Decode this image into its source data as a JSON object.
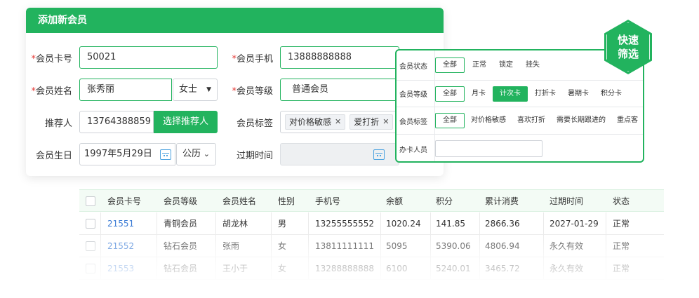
{
  "form": {
    "title": "添加新会员",
    "card_no": {
      "label_star": "*",
      "label": "会员卡号",
      "value": "50021"
    },
    "phone": {
      "label_star": "*",
      "label": "会员手机",
      "value": "13888888888"
    },
    "name": {
      "label_star": "*",
      "label": "会员姓名",
      "value": "张秀丽",
      "gender": "女士"
    },
    "level": {
      "label_star": "*",
      "label": "会员等级",
      "value": "普通会员"
    },
    "referrer": {
      "label": "推荐人",
      "value": "13764388859",
      "button": "选择推荐人"
    },
    "tags": {
      "label": "会员标签",
      "items": [
        "对价格敏感",
        "爱打折"
      ]
    },
    "birthday": {
      "label": "会员生日",
      "value": "1997年5月29日",
      "calendar_type": "公历"
    },
    "expire": {
      "label": "过期时间",
      "value": ""
    }
  },
  "quick_filter": {
    "badge_line1": "快速",
    "badge_line2": "筛选",
    "status": {
      "label": "会员状态",
      "options": [
        "全部",
        "正常",
        "锁定",
        "挂失"
      ],
      "selected": "全部"
    },
    "level": {
      "label": "会员等级",
      "options": [
        "全部",
        "月卡",
        "计次卡",
        "打折卡",
        "暑期卡",
        "积分卡"
      ],
      "selected": "计次卡"
    },
    "tags": {
      "label": "会员标签",
      "options": [
        "全部",
        "对价格敏感",
        "喜欢打折",
        "需要长期跟进的",
        "重点客"
      ],
      "selected": "全部"
    },
    "staff": {
      "label": "办卡人员",
      "value": ""
    }
  },
  "table": {
    "headers": [
      "会员卡号",
      "会员等级",
      "会员姓名",
      "性别",
      "手机号",
      "余额",
      "积分",
      "累计消费",
      "过期时间",
      "状态"
    ],
    "rows": [
      [
        "21551",
        "青铜会员",
        "胡龙林",
        "男",
        "13255555552",
        "1020.24",
        "141.85",
        "2866.36",
        "2027-01-29",
        "正常"
      ],
      [
        "21552",
        "钻石会员",
        "张雨",
        "女",
        "13811111111",
        "5095",
        "5390.06",
        "4806.94",
        "永久有效",
        "正常"
      ],
      [
        "21553",
        "钻石会员",
        "王小于",
        "女",
        "13288888888",
        "6100",
        "5240.01",
        "3465.72",
        "永久有效",
        "正常"
      ]
    ]
  },
  "colors": {
    "accent": "#22b35e",
    "link": "#3a7bd5",
    "required": "#e53935"
  }
}
